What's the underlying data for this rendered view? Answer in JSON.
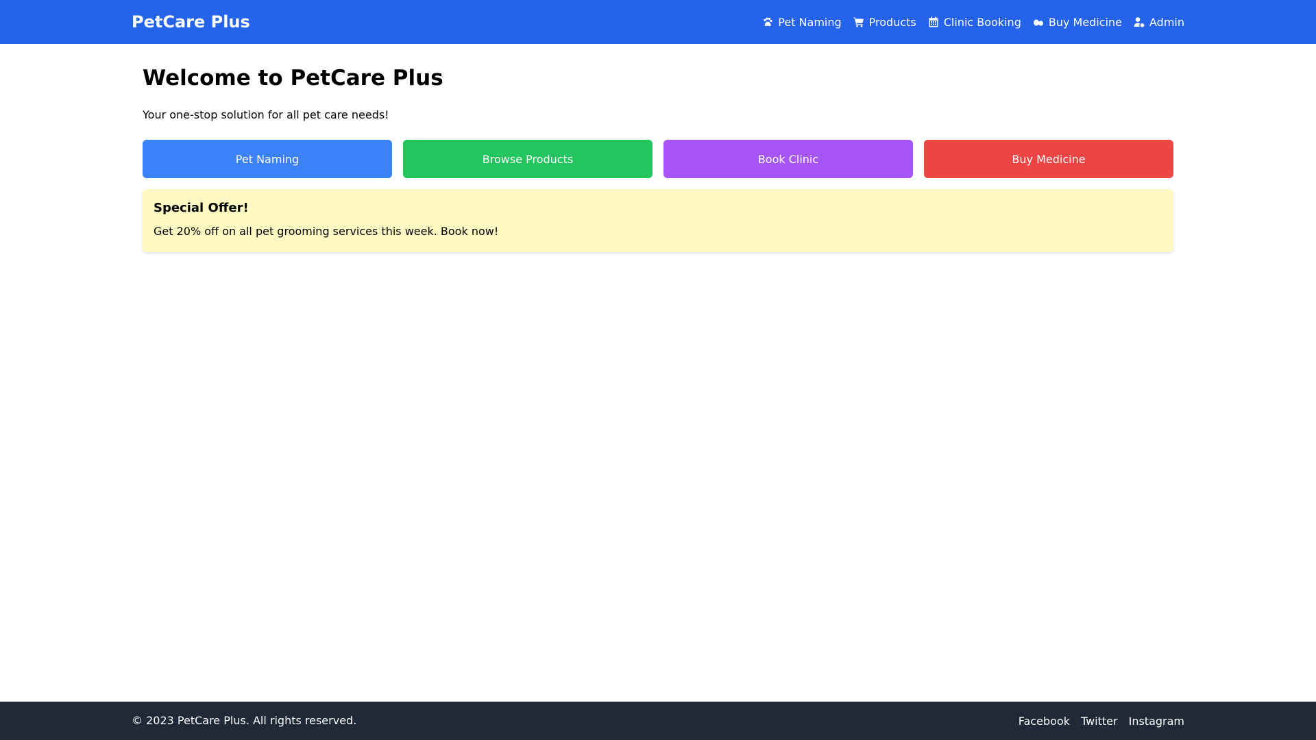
{
  "header": {
    "brand": "PetCare Plus",
    "nav": [
      {
        "label": "Pet Naming",
        "icon": "paw-icon"
      },
      {
        "label": "Products",
        "icon": "cart-icon"
      },
      {
        "label": "Clinic Booking",
        "icon": "calendar-icon"
      },
      {
        "label": "Buy Medicine",
        "icon": "pills-icon"
      },
      {
        "label": "Admin",
        "icon": "user-gear-icon"
      }
    ]
  },
  "main": {
    "title": "Welcome to PetCare Plus",
    "subtitle": "Your one-stop solution for all pet care needs!",
    "actions": [
      {
        "label": "Pet Naming",
        "color": "#3b82f6"
      },
      {
        "label": "Browse Products",
        "color": "#22c55e"
      },
      {
        "label": "Book Clinic",
        "color": "#a855f7"
      },
      {
        "label": "Buy Medicine",
        "color": "#ef4444"
      }
    ],
    "offer": {
      "title": "Special Offer!",
      "text": "Get 20% off on all pet grooming services this week. Book now!"
    }
  },
  "footer": {
    "copyright": "© 2023 PetCare Plus. All rights reserved.",
    "links": [
      "Facebook",
      "Twitter",
      "Instagram"
    ]
  },
  "colors": {
    "navbar": "#2563eb",
    "footer": "#1f2937",
    "offer_bg": "#fef9c3"
  }
}
